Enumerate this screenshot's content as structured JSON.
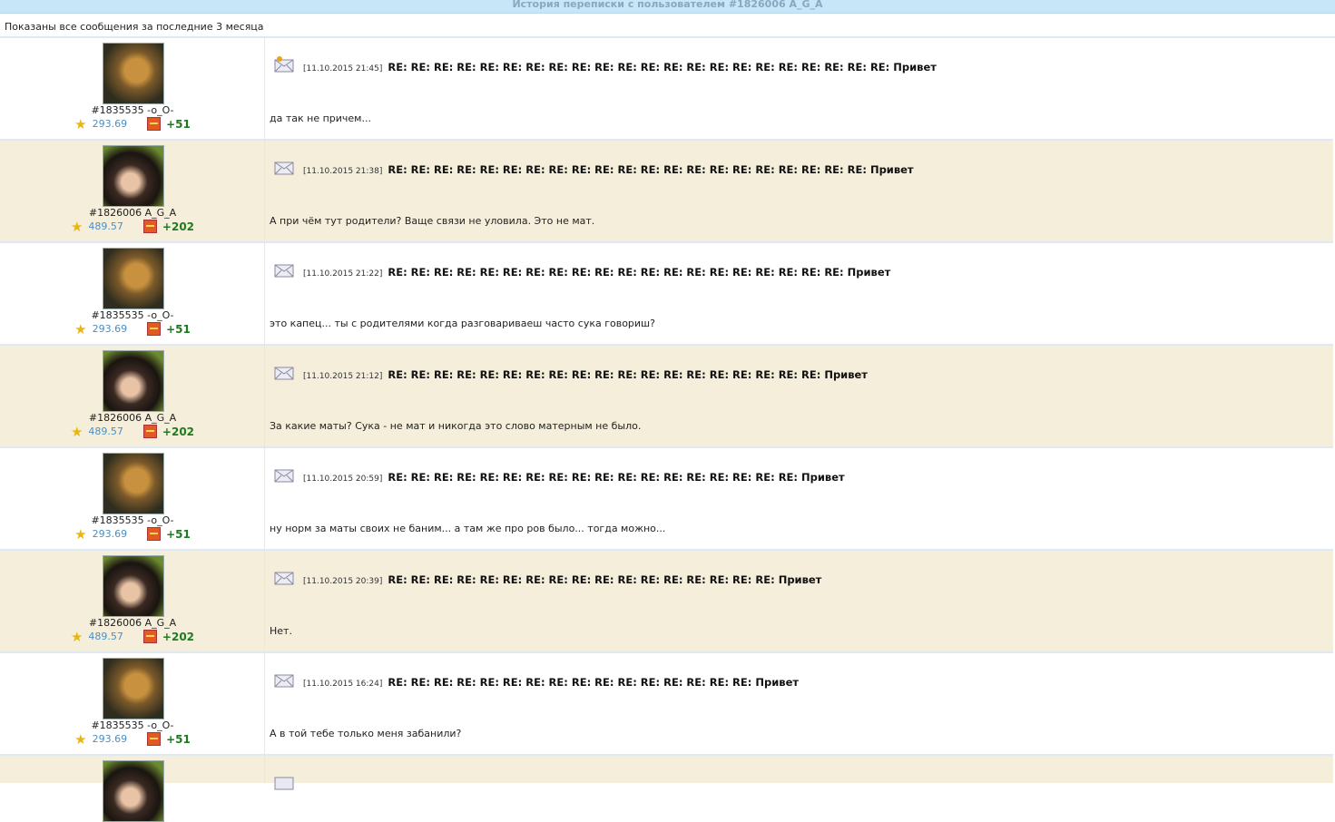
{
  "page": {
    "title": "История переписки с пользователем #1826006 A_G_A",
    "subtitle": "Показаны все сообщения за последние 3 месяца"
  },
  "messages": [
    {
      "avatar": "cat",
      "user": "#1835535 -o_O-",
      "rating": "293.69",
      "bonus": "+51",
      "date": "[11.10.2015 21:45]",
      "subject": "RE: RE: RE: RE: RE: RE: RE: RE: RE: RE: RE: RE: RE: RE: RE: RE: RE: RE: RE: RE: RE: RE: Привет",
      "text": "да так не причем...",
      "alt": false,
      "icon": "envelope-new-icon"
    },
    {
      "avatar": "girl",
      "user": "#1826006 A_G_A",
      "rating": "489.57",
      "bonus": "+202",
      "date": "[11.10.2015 21:38]",
      "subject": "RE: RE: RE: RE: RE: RE: RE: RE: RE: RE: RE: RE: RE: RE: RE: RE: RE: RE: RE: RE: RE: Привет",
      "text": "А при чём тут родители? Ваще связи не уловила. Это не мат.",
      "alt": true,
      "icon": "envelope-icon"
    },
    {
      "avatar": "cat",
      "user": "#1835535 -o_O-",
      "rating": "293.69",
      "bonus": "+51",
      "date": "[11.10.2015 21:22]",
      "subject": "RE: RE: RE: RE: RE: RE: RE: RE: RE: RE: RE: RE: RE: RE: RE: RE: RE: RE: RE: RE: Привет",
      "text": "это капец... ты с родителями когда разговариваеш часто сука говориш?",
      "alt": false,
      "icon": "envelope-icon"
    },
    {
      "avatar": "girl",
      "user": "#1826006 A_G_A",
      "rating": "489.57",
      "bonus": "+202",
      "date": "[11.10.2015 21:12]",
      "subject": "RE: RE: RE: RE: RE: RE: RE: RE: RE: RE: RE: RE: RE: RE: RE: RE: RE: RE: RE: Привет",
      "text": "За какие маты? Сука - не мат и никогда это слово матерным не было.",
      "alt": true,
      "icon": "envelope-icon"
    },
    {
      "avatar": "cat",
      "user": "#1835535 -o_O-",
      "rating": "293.69",
      "bonus": "+51",
      "date": "[11.10.2015 20:59]",
      "subject": "RE: RE: RE: RE: RE: RE: RE: RE: RE: RE: RE: RE: RE: RE: RE: RE: RE: RE: Привет",
      "text": "ну норм за маты своих не баним... а там же про ров было... тогда можно...",
      "alt": false,
      "icon": "envelope-icon"
    },
    {
      "avatar": "girl",
      "user": "#1826006 A_G_A",
      "rating": "489.57",
      "bonus": "+202",
      "date": "[11.10.2015 20:39]",
      "subject": "RE: RE: RE: RE: RE: RE: RE: RE: RE: RE: RE: RE: RE: RE: RE: RE: RE: Привет",
      "text": "Нет.",
      "alt": true,
      "icon": "envelope-icon"
    },
    {
      "avatar": "cat",
      "user": "#1835535 -o_O-",
      "rating": "293.69",
      "bonus": "+51",
      "date": "[11.10.2015 16:24]",
      "subject": "RE: RE: RE: RE: RE: RE: RE: RE: RE: RE: RE: RE: RE: RE: RE: RE: Привет",
      "text": "А в той тебе только меня забанили?",
      "alt": false,
      "icon": "envelope-icon"
    }
  ]
}
